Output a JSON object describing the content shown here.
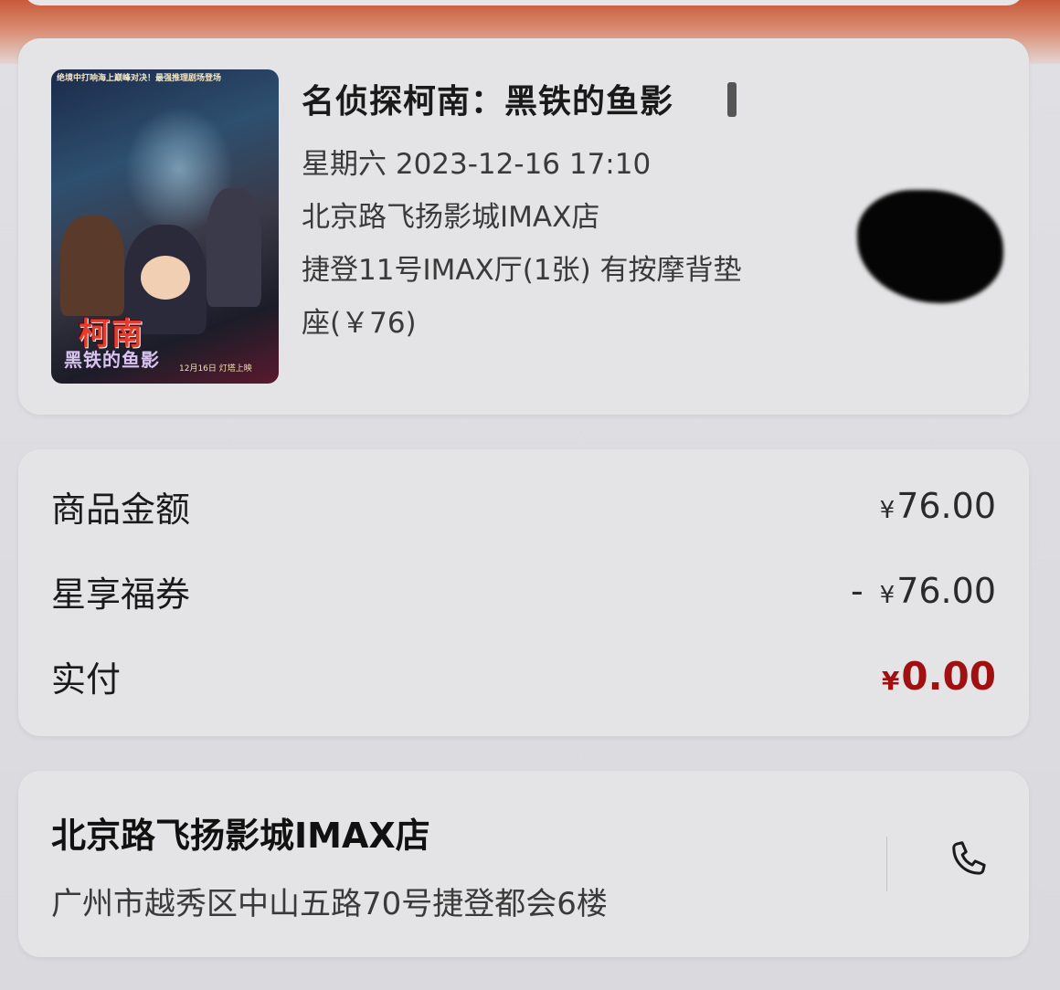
{
  "movie": {
    "title": "名侦探柯南：黑铁的鱼影",
    "datetime": "星期六 2023-12-16 17:10",
    "cinema": "北京路飞扬影城IMAX店",
    "hall": "捷登11号IMAX厅(1张)  有按摩背垫",
    "seat_price": "座(￥76)",
    "poster": {
      "tagline": "绝境中打响海上巅峰对决！最强推理剧场登场",
      "logo": "柯南",
      "subtitle": "黑铁的鱼影",
      "release": "12月16日 灯塔上映"
    }
  },
  "pricing": {
    "rows": [
      {
        "label": "商品金额",
        "currency": "¥",
        "value": "76.00",
        "prefix": ""
      },
      {
        "label": "星享福券",
        "currency": "¥",
        "value": "76.00",
        "prefix": "-"
      },
      {
        "label": "实付",
        "currency": "¥",
        "value": "0.00",
        "prefix": ""
      }
    ],
    "paid_color": "#a01010"
  },
  "cinema_card": {
    "name": "北京路飞扬影城IMAX店",
    "address": "广州市越秀区中山五路70号捷登都会6楼",
    "phone_icon": "phone-icon"
  },
  "colors": {
    "header_accent": "#c85a3a",
    "card_bg": "#e4e4e6"
  }
}
